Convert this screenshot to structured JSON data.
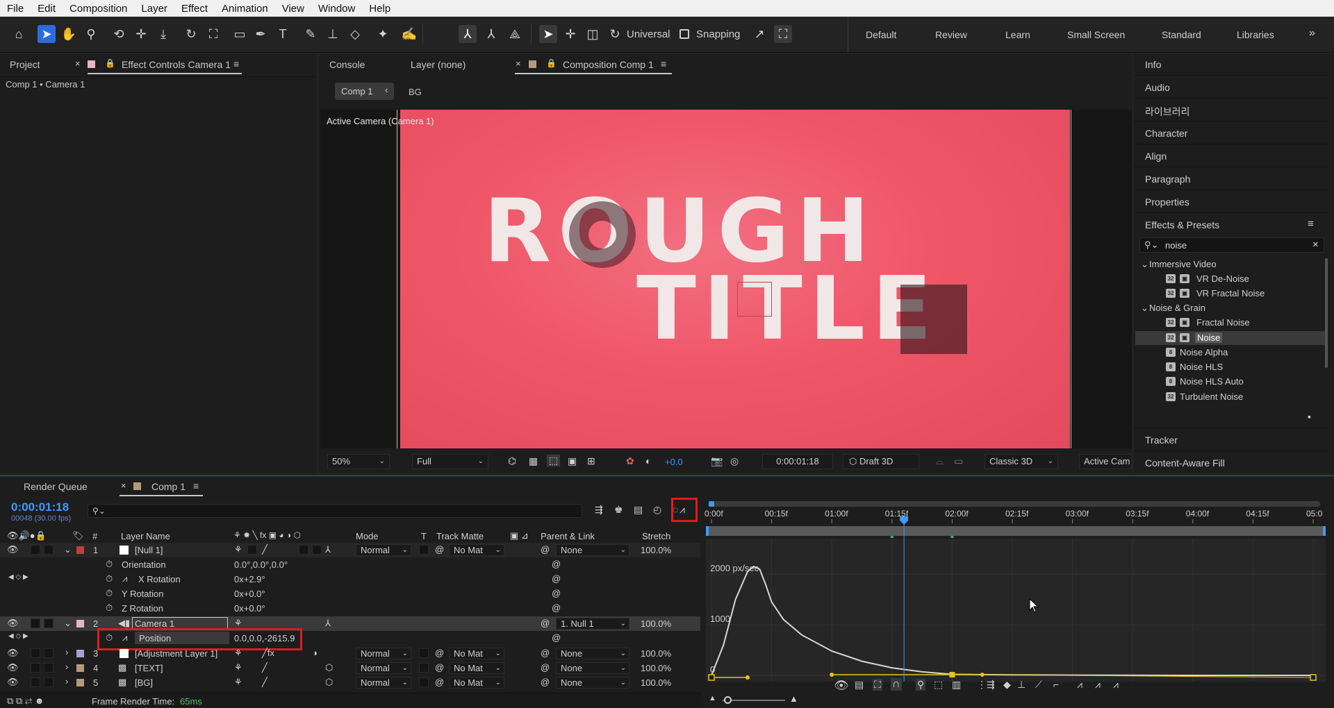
{
  "menu": [
    "File",
    "Edit",
    "Composition",
    "Layer",
    "Effect",
    "Animation",
    "View",
    "Window",
    "Help"
  ],
  "toolbar": {
    "universal_label": "Universal",
    "snapping_label": "Snapping"
  },
  "workspaces": [
    "Default",
    "Review",
    "Learn",
    "Small Screen",
    "Standard",
    "Libraries"
  ],
  "left_panel": {
    "tab_project": "Project",
    "tab_effect_controls": "Effect Controls Camera 1",
    "breadcrumb": "Comp 1 • Camera 1"
  },
  "center_panel": {
    "tab_console": "Console",
    "tab_layer": "Layer (none)",
    "tab_composition": "Composition Comp 1",
    "flow_comp": "Comp 1",
    "flow_bg": "BG",
    "viewer_label": "Active Camera (Camera 1)",
    "title_line1": "ROUGH",
    "title_line2": "TITLE",
    "bg_color": "#f1566b",
    "footer": {
      "zoom": "50%",
      "resolution": "Full",
      "exposure": "+0.0",
      "timecode": "0:00:01:18",
      "renderer": "Draft 3D",
      "view_mode": "Classic 3D",
      "camera": "Active Cam"
    }
  },
  "right_panel": {
    "items": [
      "Info",
      "Audio",
      "라이브러리",
      "Character",
      "Align",
      "Paragraph",
      "Properties"
    ],
    "effects_title": "Effects & Presets",
    "search_value": "noise",
    "groups": [
      {
        "name": "Immersive Video",
        "items": [
          "VR De-Noise",
          "VR Fractal Noise"
        ]
      },
      {
        "name": "Noise & Grain",
        "items": [
          "Fractal Noise",
          "Noise",
          "Noise Alpha",
          "Noise HLS",
          "Noise HLS Auto",
          "Turbulent Noise"
        ]
      }
    ],
    "bottom_items": [
      "Tracker",
      "Content-Aware Fill"
    ]
  },
  "timeline": {
    "tab_render_queue": "Render Queue",
    "tab_comp": "Comp 1",
    "timecode": "0:00:01:18",
    "frame_info": "00048 (30.00 fps)",
    "headers": {
      "number": "#",
      "layer_name": "Layer Name",
      "mode": "Mode",
      "t": "T",
      "track_matte": "Track Matte",
      "parent": "Parent & Link",
      "stretch": "Stretch"
    },
    "layers": [
      {
        "num": "1",
        "name": "[Null 1]",
        "mode": "Normal",
        "matte": "No Mat",
        "parent": "None",
        "stretch": "100.0%",
        "color": "#c0403a"
      },
      {
        "num": "2",
        "name": "Camera 1",
        "parent": "1. Null 1",
        "stretch": "100.0%",
        "color": "#e8b5c3"
      },
      {
        "num": "3",
        "name": "[Adjustment Layer 1]",
        "mode": "Normal",
        "matte": "No Mat",
        "parent": "None",
        "stretch": "100.0%",
        "color": "#a9a2d1"
      },
      {
        "num": "4",
        "name": "[TEXT]",
        "mode": "Normal",
        "matte": "No Mat",
        "parent": "None",
        "stretch": "100.0%",
        "color": "#b59a7a"
      },
      {
        "num": "5",
        "name": "[BG]",
        "mode": "Normal",
        "matte": "No Mat",
        "parent": "None",
        "stretch": "100.0%",
        "color": "#b59a7a"
      }
    ],
    "null_props": [
      {
        "name": "Orientation",
        "value": "0.0°,0.0°,0.0°"
      },
      {
        "name": "X Rotation",
        "value": "0x+2.9°"
      },
      {
        "name": "Y Rotation",
        "value": "0x+0.0°"
      },
      {
        "name": "Z Rotation",
        "value": "0x+0.0°"
      }
    ],
    "camera_prop": {
      "name": "Position",
      "value": "0.0,0.0,-2615.9"
    },
    "ruler": [
      "0:00f",
      "00:15f",
      "01:00f",
      "01:15f",
      "02:00f",
      "02:15f",
      "03:00f",
      "03:15f",
      "04:00f",
      "04:15f",
      "05:0"
    ],
    "graph_labels": [
      "2000 px/sec",
      "1000",
      "0"
    ],
    "footer": {
      "render_time_label": "Frame Render Time:",
      "render_time_value": "65ms"
    }
  },
  "chart_data": {
    "type": "line",
    "title": "",
    "xlabel": "",
    "ylabel": "px/sec",
    "ylim": [
      0,
      2400
    ],
    "xlim": [
      0,
      5
    ],
    "series": [
      {
        "x": [
          0,
          0.1,
          0.2,
          0.3,
          0.35,
          0.4,
          0.45,
          0.5,
          0.6,
          0.75,
          1.0,
          1.25,
          1.5,
          1.75,
          2.0,
          2.5,
          3.0,
          4.0,
          5.0
        ],
        "values": [
          0,
          600,
          1500,
          2050,
          2150,
          2100,
          1800,
          1450,
          1100,
          800,
          480,
          280,
          150,
          70,
          20,
          10,
          5,
          0,
          0
        ]
      }
    ]
  }
}
